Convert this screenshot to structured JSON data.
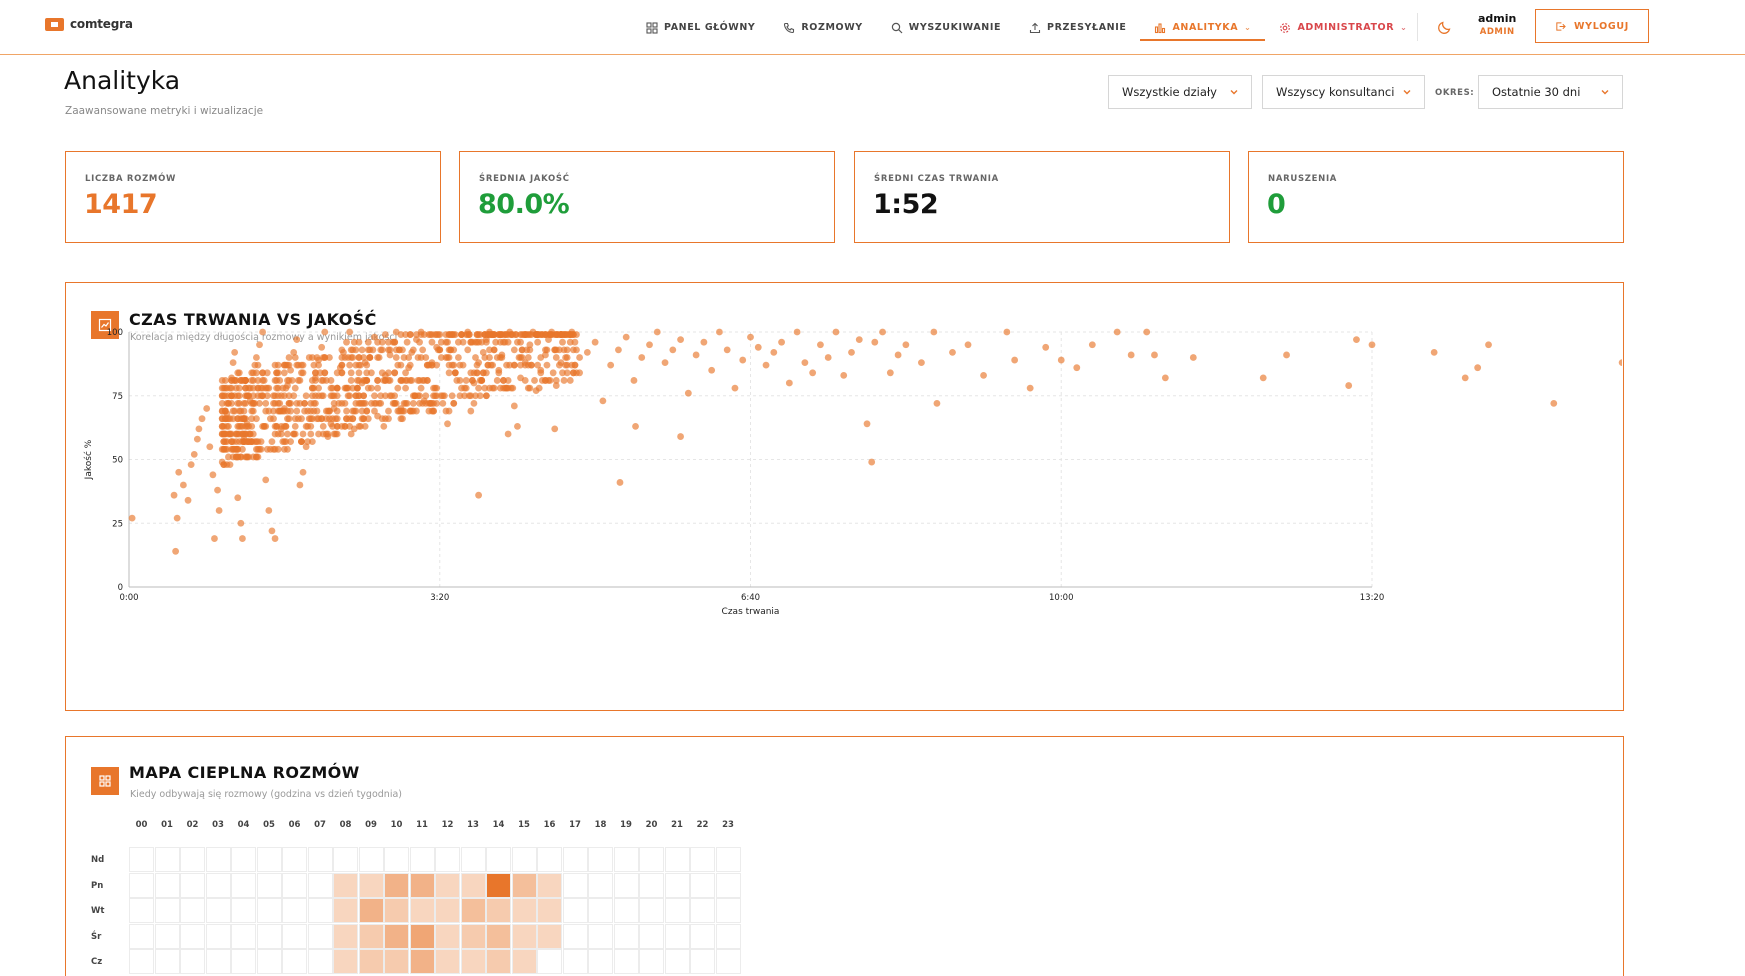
{
  "brand": {
    "name": "comtegra"
  },
  "nav": {
    "items": [
      {
        "key": "dashboard",
        "label": "PANEL GŁÓWNY",
        "icon": "grid-icon"
      },
      {
        "key": "calls",
        "label": "ROZMOWY",
        "icon": "phone-icon"
      },
      {
        "key": "search",
        "label": "WYSZUKIWANIE",
        "icon": "search-icon"
      },
      {
        "key": "upload",
        "label": "PRZESYŁANIE",
        "icon": "upload-icon"
      },
      {
        "key": "analytics",
        "label": "ANALITYKA",
        "icon": "bar-chart-icon",
        "active": true
      },
      {
        "key": "admin",
        "label": "ADMINISTRATOR",
        "icon": "gear-icon"
      }
    ]
  },
  "user": {
    "name": "admin",
    "role": "ADMIN",
    "logout_label": "WYLOGUJ"
  },
  "page": {
    "title": "Analityka",
    "subtitle": "Zaawansowane metryki i wizualizacje"
  },
  "filters": {
    "department": "Wszystkie działy",
    "agent": "Wszyscy konsultanci",
    "period_label": "OKRES:",
    "period": "Ostatnie 30 dni"
  },
  "kpis": [
    {
      "label": "LICZBA ROZMÓW",
      "value": "1417",
      "color": "#e8762b"
    },
    {
      "label": "ŚREDNIA JAKOŚĆ",
      "value": "80.0%",
      "color": "#1f9d3a"
    },
    {
      "label": "ŚREDNI CZAS TRWANIA",
      "value": "1:52",
      "color": "#111111"
    },
    {
      "label": "NARUSZENIA",
      "value": "0",
      "color": "#1f9d3a"
    }
  ],
  "scatter_card": {
    "title": "CZAS TRWANIA VS JAKOŚĆ",
    "subtitle": "Korelacja między długością rozmowy a wynikiem jakości"
  },
  "heatmap_card": {
    "title": "MAPA CIEPLNA ROZMÓW",
    "subtitle": "Kiedy odbywają się rozmowy (godzina vs dzień tygodnia)"
  },
  "colors": {
    "accent": "#e8762b",
    "good": "#1f9d3a",
    "admin": "#d9474b"
  },
  "chart_data": [
    {
      "type": "scatter",
      "title": "CZAS TRWANIA VS JAKOŚĆ",
      "xlabel": "Czas trwania",
      "ylabel": "Jakość %",
      "x_unit": "seconds",
      "xlim": [
        0,
        800
      ],
      "ylim": [
        0,
        100
      ],
      "x_ticks": [
        "0:00",
        "3:20",
        "6:40",
        "10:00",
        "13:20"
      ],
      "y_ticks": [
        "0",
        "25",
        "50",
        "75",
        "100"
      ],
      "grid": true,
      "points": [
        [
          2,
          27
        ],
        [
          30,
          14
        ],
        [
          29,
          36
        ],
        [
          31,
          27
        ],
        [
          32,
          45
        ],
        [
          35,
          40
        ],
        [
          38,
          34
        ],
        [
          40,
          48
        ],
        [
          42,
          52
        ],
        [
          44,
          58
        ],
        [
          45,
          62
        ],
        [
          47,
          66
        ],
        [
          50,
          70
        ],
        [
          52,
          55
        ],
        [
          54,
          44
        ],
        [
          55,
          19
        ],
        [
          57,
          38
        ],
        [
          58,
          30
        ],
        [
          60,
          49
        ],
        [
          62,
          60
        ],
        [
          63,
          68
        ],
        [
          64,
          72
        ],
        [
          65,
          78
        ],
        [
          66,
          82
        ],
        [
          67,
          88
        ],
        [
          68,
          92
        ],
        [
          70,
          35
        ],
        [
          72,
          25
        ],
        [
          73,
          19
        ],
        [
          74,
          58
        ],
        [
          76,
          64
        ],
        [
          78,
          73
        ],
        [
          80,
          84
        ],
        [
          82,
          90
        ],
        [
          84,
          95
        ],
        [
          86,
          100
        ],
        [
          88,
          42
        ],
        [
          90,
          30
        ],
        [
          92,
          22
        ],
        [
          94,
          19
        ],
        [
          96,
          54
        ],
        [
          98,
          62
        ],
        [
          100,
          70
        ],
        [
          102,
          79
        ],
        [
          104,
          85
        ],
        [
          106,
          92
        ],
        [
          108,
          97
        ],
        [
          110,
          40
        ],
        [
          112,
          45
        ],
        [
          114,
          55
        ],
        [
          116,
          66
        ],
        [
          118,
          75
        ],
        [
          120,
          82
        ],
        [
          122,
          89
        ],
        [
          124,
          94
        ],
        [
          126,
          100
        ],
        [
          128,
          59
        ],
        [
          130,
          64
        ],
        [
          132,
          70
        ],
        [
          134,
          78
        ],
        [
          136,
          86
        ],
        [
          138,
          92
        ],
        [
          140,
          96
        ],
        [
          142,
          100
        ],
        [
          145,
          62
        ],
        [
          148,
          72
        ],
        [
          150,
          80
        ],
        [
          152,
          88
        ],
        [
          155,
          93
        ],
        [
          158,
          98
        ],
        [
          160,
          67
        ],
        [
          162,
          75
        ],
        [
          165,
          83
        ],
        [
          168,
          91
        ],
        [
          170,
          96
        ],
        [
          172,
          100
        ],
        [
          175,
          70
        ],
        [
          178,
          78
        ],
        [
          180,
          86
        ],
        [
          182,
          92
        ],
        [
          185,
          97
        ],
        [
          188,
          100
        ],
        [
          190,
          73
        ],
        [
          192,
          81
        ],
        [
          195,
          88
        ],
        [
          198,
          94
        ],
        [
          200,
          99
        ],
        [
          205,
          64
        ],
        [
          208,
          75
        ],
        [
          210,
          84
        ],
        [
          212,
          90
        ],
        [
          215,
          96
        ],
        [
          218,
          100
        ],
        [
          220,
          69
        ],
        [
          222,
          80
        ],
        [
          225,
          88
        ],
        [
          228,
          92
        ],
        [
          230,
          97
        ],
        [
          232,
          100
        ],
        [
          235,
          78
        ],
        [
          238,
          85
        ],
        [
          240,
          91
        ],
        [
          242,
          96
        ],
        [
          245,
          100
        ],
        [
          248,
          71
        ],
        [
          250,
          63
        ],
        [
          252,
          82
        ],
        [
          255,
          88
        ],
        [
          258,
          95
        ],
        [
          260,
          100
        ],
        [
          262,
          77
        ],
        [
          265,
          85
        ],
        [
          268,
          91
        ],
        [
          270,
          97
        ],
        [
          272,
          100
        ],
        [
          275,
          79
        ],
        [
          278,
          88
        ],
        [
          280,
          93
        ],
        [
          285,
          100
        ],
        [
          290,
          84
        ],
        [
          295,
          92
        ],
        [
          300,
          96
        ],
        [
          305,
          73
        ],
        [
          310,
          87
        ],
        [
          315,
          93
        ],
        [
          320,
          98
        ],
        [
          325,
          81
        ],
        [
          330,
          90
        ],
        [
          335,
          95
        ],
        [
          340,
          100
        ],
        [
          345,
          88
        ],
        [
          350,
          93
        ],
        [
          355,
          97
        ],
        [
          360,
          76
        ],
        [
          365,
          91
        ],
        [
          370,
          96
        ],
        [
          375,
          85
        ],
        [
          380,
          100
        ],
        [
          385,
          93
        ],
        [
          390,
          78
        ],
        [
          395,
          89
        ],
        [
          400,
          98
        ],
        [
          405,
          94
        ],
        [
          410,
          87
        ],
        [
          415,
          92
        ],
        [
          420,
          96
        ],
        [
          425,
          80
        ],
        [
          430,
          100
        ],
        [
          435,
          88
        ],
        [
          440,
          84
        ],
        [
          445,
          95
        ],
        [
          450,
          90
        ],
        [
          455,
          100
        ],
        [
          460,
          83
        ],
        [
          465,
          92
        ],
        [
          470,
          97
        ],
        [
          475,
          64
        ],
        [
          478,
          49
        ],
        [
          480,
          96
        ],
        [
          485,
          100
        ],
        [
          490,
          84
        ],
        [
          495,
          91
        ],
        [
          500,
          95
        ],
        [
          510,
          88
        ],
        [
          518,
          100
        ],
        [
          520,
          72
        ],
        [
          530,
          92
        ],
        [
          540,
          95
        ],
        [
          550,
          83
        ],
        [
          565,
          100
        ],
        [
          570,
          89
        ],
        [
          580,
          78
        ],
        [
          590,
          94
        ],
        [
          600,
          89
        ],
        [
          610,
          86
        ],
        [
          620,
          95
        ],
        [
          636,
          100
        ],
        [
          645,
          91
        ],
        [
          655,
          100
        ],
        [
          660,
          91
        ],
        [
          667,
          82
        ],
        [
          685,
          90
        ],
        [
          730,
          82
        ],
        [
          745,
          91
        ],
        [
          785,
          79
        ],
        [
          790,
          97
        ],
        [
          800,
          95
        ],
        [
          840,
          92
        ],
        [
          860,
          82
        ],
        [
          868,
          86
        ],
        [
          875,
          95
        ],
        [
          917,
          72
        ],
        [
          961,
          88
        ],
        [
          966,
          90
        ],
        [
          972,
          100
        ],
        [
          1010,
          79
        ],
        [
          225,
          36
        ],
        [
          244,
          60
        ],
        [
          274,
          62
        ],
        [
          316,
          41
        ],
        [
          326,
          63
        ],
        [
          355,
          59
        ]
      ]
    },
    {
      "type": "heatmap",
      "title": "MAPA CIEPLNA ROZMÓW",
      "x_categories": [
        "00",
        "01",
        "02",
        "03",
        "04",
        "05",
        "06",
        "07",
        "08",
        "09",
        "10",
        "11",
        "12",
        "13",
        "14",
        "15",
        "16",
        "17",
        "18",
        "19",
        "20",
        "21",
        "22",
        "23"
      ],
      "y_categories": [
        "Nd",
        "Pn",
        "Wt",
        "Śr",
        "Cz"
      ],
      "values": [
        [
          0,
          0,
          0,
          0,
          0,
          0,
          0,
          0,
          0,
          0,
          0,
          0,
          0,
          0,
          0,
          0,
          0,
          0,
          0,
          0,
          0,
          0,
          0,
          0
        ],
        [
          0,
          0,
          0,
          0,
          0,
          0,
          0,
          0,
          2,
          2,
          5,
          5,
          2,
          2,
          10,
          4,
          2,
          0,
          0,
          0,
          0,
          0,
          0,
          0
        ],
        [
          0,
          0,
          0,
          0,
          0,
          0,
          0,
          0,
          2,
          5,
          3,
          2,
          2,
          4,
          3,
          2,
          2,
          0,
          0,
          0,
          0,
          0,
          0,
          0
        ],
        [
          0,
          0,
          0,
          0,
          0,
          0,
          0,
          0,
          2,
          3,
          5,
          6,
          2,
          3,
          4,
          2,
          2,
          0,
          0,
          0,
          0,
          0,
          0,
          0
        ],
        [
          0,
          0,
          0,
          0,
          0,
          0,
          0,
          0,
          2,
          3,
          3,
          5,
          2,
          2,
          3,
          2,
          0,
          0,
          0,
          0,
          0,
          0,
          0,
          0
        ]
      ]
    }
  ]
}
